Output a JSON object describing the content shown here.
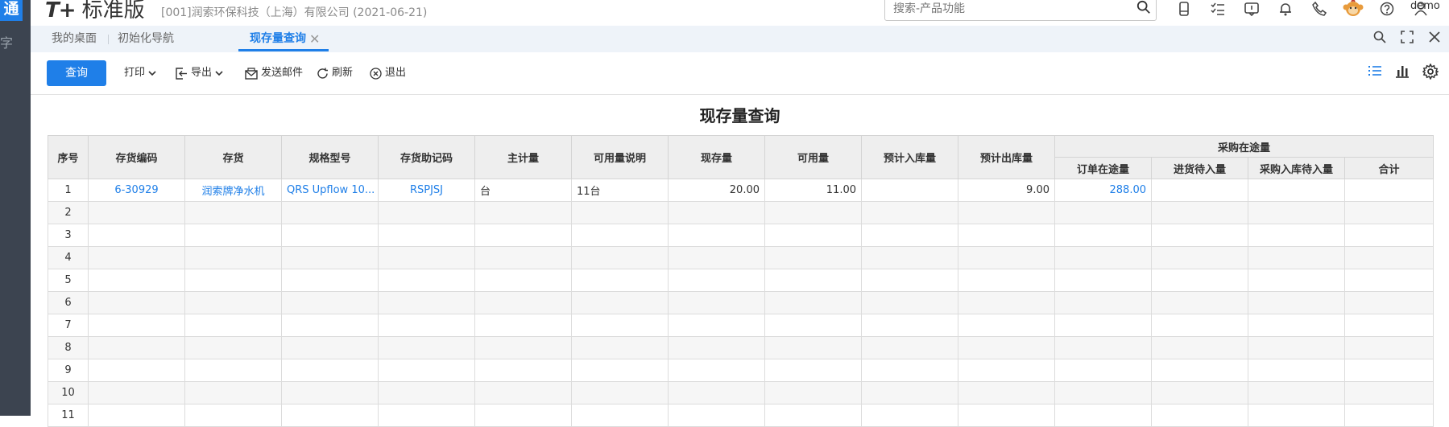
{
  "rail": {
    "logo": "通",
    "glyph": "字"
  },
  "header": {
    "brand_prefix": "T+",
    "brand_name": "标准版",
    "company": "[001]润索环保科技（上海）有限公司   (2021-06-21)",
    "search_placeholder": "搜索-产品功能",
    "user": "demo"
  },
  "tabs": [
    {
      "label": "我的桌面"
    },
    {
      "label": "初始化导航"
    },
    {
      "label": "现存量查询"
    }
  ],
  "toolbar": {
    "query": "查询",
    "print": "打印",
    "export": "导出",
    "email": "发送邮件",
    "refresh": "刷新",
    "exit": "退出"
  },
  "report": {
    "title": "现存量查询",
    "columns": {
      "seq": "序号",
      "code": "存货编码",
      "item": "存货",
      "spec": "规格型号",
      "mnemonic": "存货助记码",
      "unit": "主计量",
      "avail_note": "可用量说明",
      "onhand": "现存量",
      "available": "可用量",
      "exp_in": "预计入库量",
      "exp_out": "预计出库量",
      "purchase_group": "采购在途量",
      "order_transit": "订单在途量",
      "arrival_pending": "进货待入量",
      "purchase_pending": "采购入库待入量",
      "total": "合计"
    },
    "rows": [
      {
        "seq": "1",
        "code": "6-30929",
        "item": "润索牌净水机",
        "spec": "QRS Upflow 10...",
        "mnemonic": "RSPJSJ",
        "unit": "台",
        "avail_note": "11台",
        "onhand": "20.00",
        "available": "11.00",
        "exp_in": "",
        "exp_out": "9.00",
        "order_transit": "288.00",
        "arrival_pending": "",
        "purchase_pending": "",
        "total": ""
      },
      {
        "seq": "2"
      },
      {
        "seq": "3"
      },
      {
        "seq": "4"
      },
      {
        "seq": "5"
      },
      {
        "seq": "6"
      },
      {
        "seq": "7"
      },
      {
        "seq": "8"
      },
      {
        "seq": "9"
      },
      {
        "seq": "10"
      },
      {
        "seq": "11"
      }
    ]
  },
  "colors": {
    "accent": "#1f7fe8",
    "rail": "#3c4450"
  }
}
